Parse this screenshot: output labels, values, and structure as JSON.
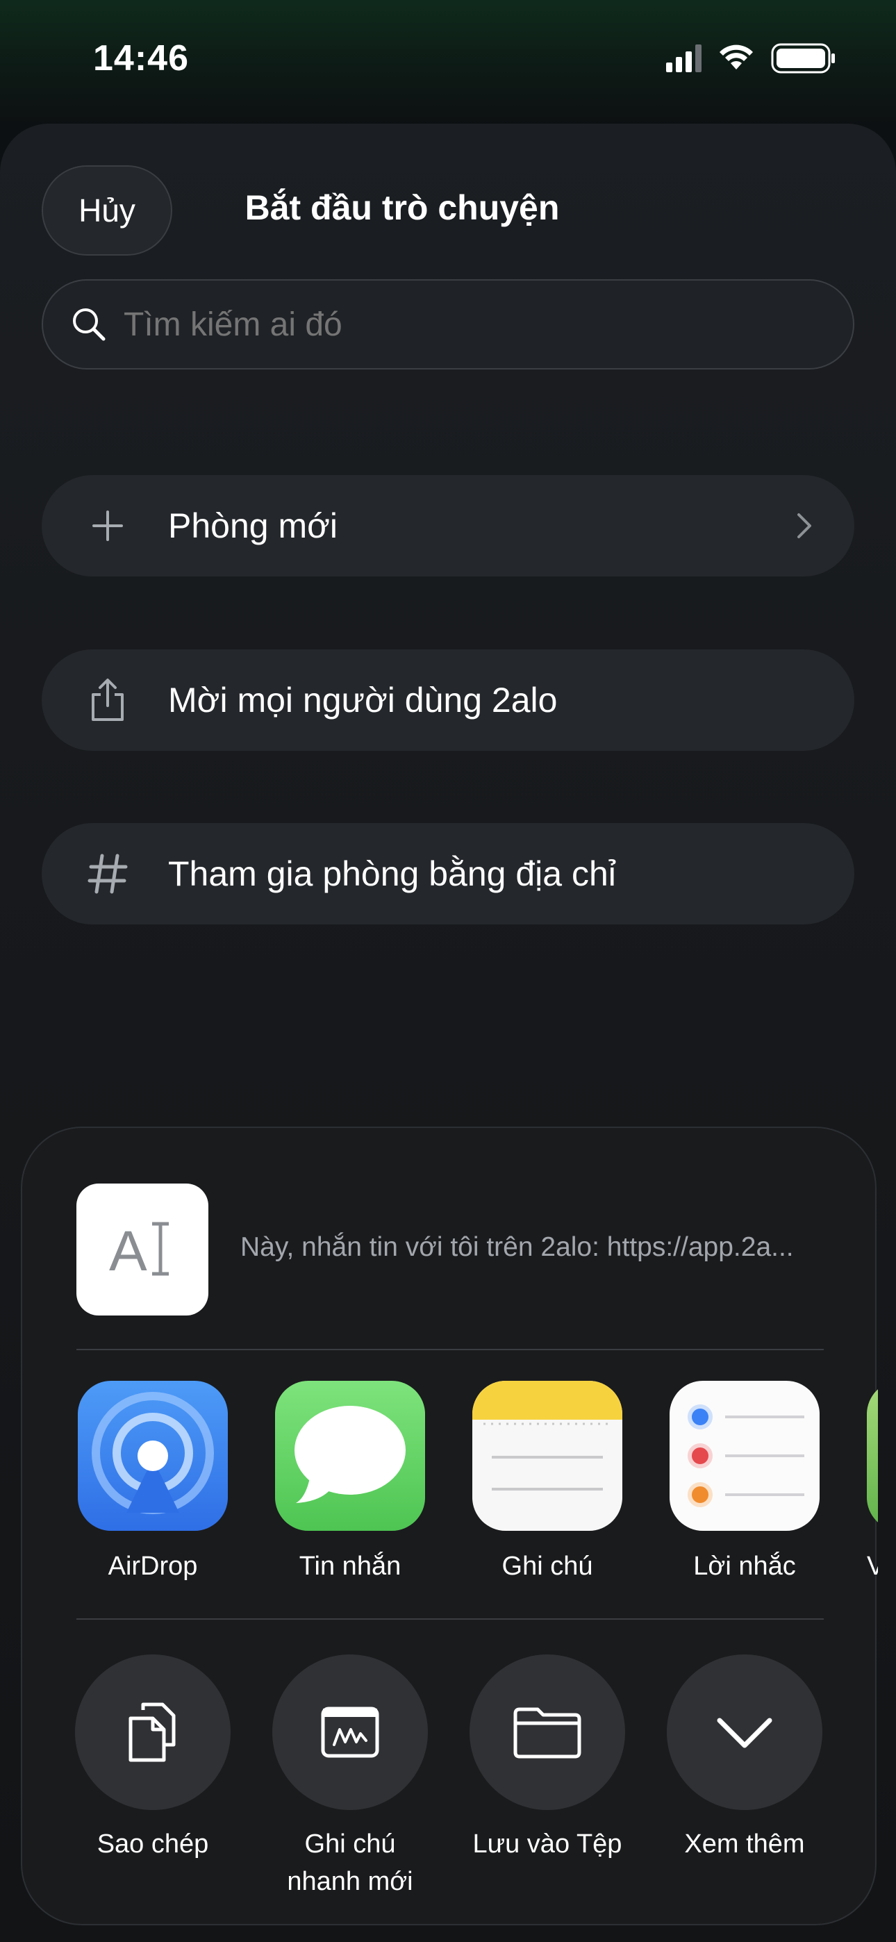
{
  "status_bar": {
    "time": "14:46",
    "battery_icon": "battery-icon",
    "wifi_icon": "wifi-icon",
    "signal_icon": "cellular-signal-icon"
  },
  "header": {
    "cancel_label": "Hủy",
    "title": "Bắt đầu trò chuyện"
  },
  "search": {
    "placeholder": "Tìm kiếm ai đó",
    "icon": "search-icon"
  },
  "menu": [
    {
      "icon": "plus-icon",
      "label": "Phòng mới",
      "has_chevron": true
    },
    {
      "icon": "share-icon",
      "label": "Mời mọi người dùng 2alo"
    },
    {
      "icon": "hash-icon",
      "label": "Tham gia phòng bằng địa chỉ"
    }
  ],
  "share_sheet": {
    "preview_text": "Này, nhắn tin với tôi trên 2alo: https://app.2a...",
    "apps": [
      {
        "label": "AirDrop",
        "icon": "airdrop-icon"
      },
      {
        "label": "Tin nhắn",
        "icon": "messages-icon"
      },
      {
        "label": "Ghi chú",
        "icon": "notes-icon"
      },
      {
        "label": "Lời nhắc",
        "icon": "reminders-icon"
      },
      {
        "label": "Vi",
        "icon": "partial-app-icon"
      }
    ],
    "actions": [
      {
        "label": "Sao chép",
        "icon": "copy-icon"
      },
      {
        "label": "Ghi chú nhanh mới",
        "label_line1": "Ghi chú",
        "label_line2": "nhanh mới",
        "icon": "quick-note-icon"
      },
      {
        "label": "Lưu vào Tệp",
        "icon": "folder-icon"
      },
      {
        "label": "Xem thêm",
        "icon": "chevron-down-icon"
      }
    ]
  },
  "colors": {
    "background": "#121416",
    "row": "#24272b",
    "airdrop_blue": "#3f86f2",
    "messages_green": "#5fd063",
    "notes_yellow": "#f7d23f"
  }
}
